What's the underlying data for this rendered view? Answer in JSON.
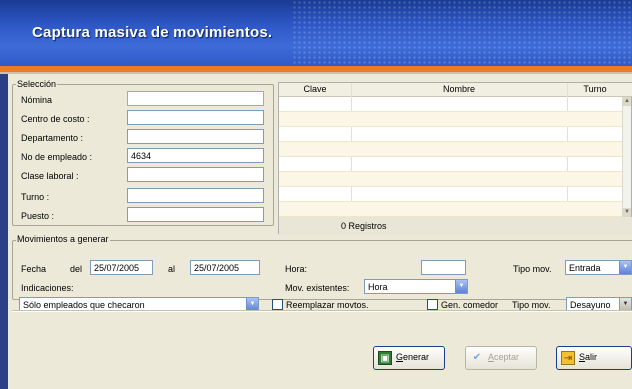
{
  "window": {
    "title": "Captura masiva de movimientos."
  },
  "seleccion": {
    "legend": "Selección",
    "fields": [
      {
        "label": "Nómina",
        "value": ""
      },
      {
        "label": "Centro de costo :",
        "value": ""
      },
      {
        "label": "Departamento :",
        "value": ""
      },
      {
        "label": "No de empleado :",
        "value": "4634"
      },
      {
        "label": "Clase laboral :",
        "value": ""
      },
      {
        "label": "Turno :",
        "value": ""
      },
      {
        "label": "Puesto :",
        "value": ""
      }
    ]
  },
  "grid": {
    "columns": [
      "Clave",
      "Nombre",
      "Turno"
    ],
    "rows": [],
    "footer": "0 Registros"
  },
  "movimientos": {
    "legend": "Movimientos a generar",
    "fecha_label": "Fecha",
    "del_label": "del",
    "fecha_desde": "25/07/2005",
    "al_label": "al",
    "fecha_hasta": "25/07/2005",
    "hora_label": "Hora:",
    "hora_value": "",
    "tipo_mov_label": "Tipo mov.",
    "tipo_mov_value": "Entrada",
    "indicaciones_label": "Indicaciones:",
    "indicaciones_value": "Sólo empleados que checaron",
    "mov_existentes_label": "Mov. existentes:",
    "mov_existentes_value": "Hora",
    "reemplazar_label": "Reemplazar movtos.",
    "reemplazar_checked": false,
    "gen_comedor_label": "Gen. comedor",
    "gen_comedor_checked": false,
    "tipo_mov2_label": "Tipo mov.",
    "tipo_mov2_value": "Desayuno"
  },
  "buttons": {
    "generar_first": "G",
    "generar_rest": "enerar",
    "aceptar_first": "A",
    "aceptar_rest": "ceptar",
    "salir_first": "S",
    "salir_rest": "alir"
  },
  "colors": {
    "title_bar": "#2d56c4",
    "accent_stripe": "#f0782a",
    "grid_alt_row": "#fbf6e6"
  },
  "icons": [
    "generar-icon",
    "aceptar-check-icon",
    "salir-icon",
    "chevron-down-icon"
  ]
}
